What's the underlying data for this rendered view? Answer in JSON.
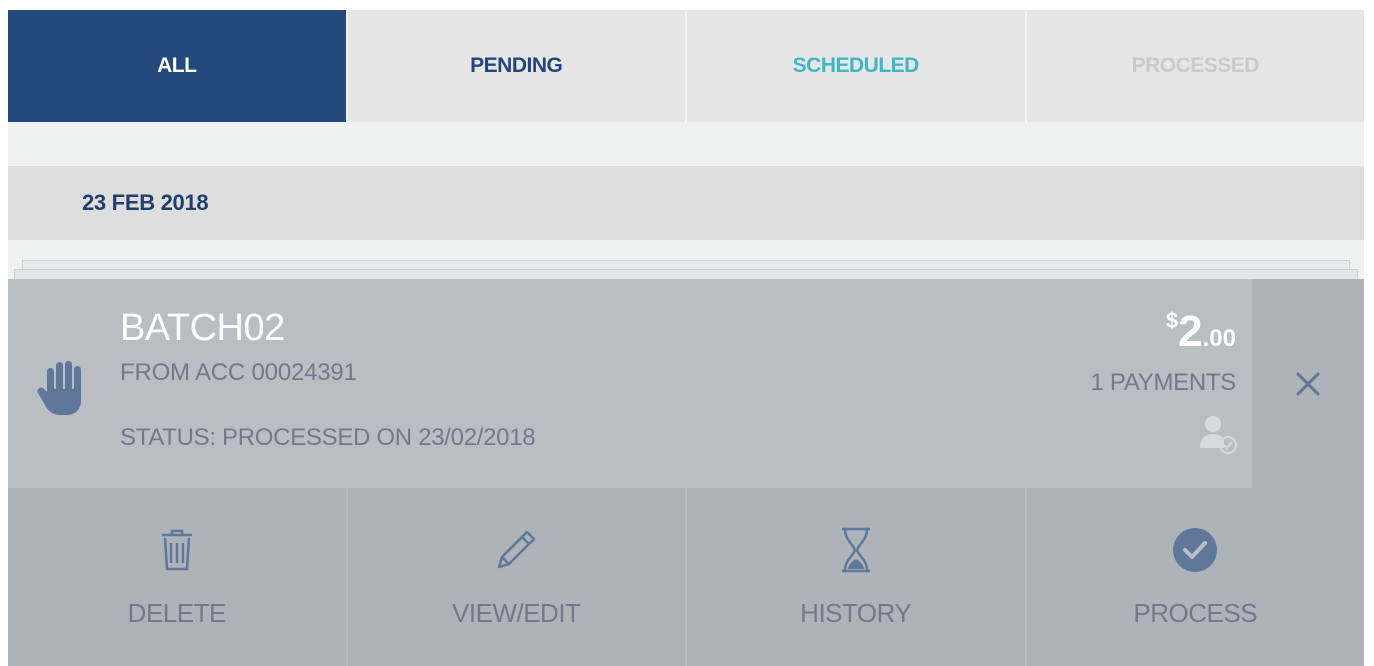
{
  "tabs": [
    {
      "label": "ALL",
      "state": "active"
    },
    {
      "label": "PENDING",
      "state": "normal"
    },
    {
      "label": "SCHEDULED",
      "state": "normal"
    },
    {
      "label": "PROCESSED",
      "state": "disabled"
    }
  ],
  "date_header": "23 FEB 2018",
  "batch": {
    "name": "BATCH02",
    "from_account": "FROM ACC 00024391",
    "status": "STATUS: PROCESSED ON 23/02/2018",
    "amount": {
      "currency": "$",
      "major": "2",
      "minor": ".00"
    },
    "payments": "1 PAYMENTS",
    "icons": {
      "left": "hand-stop-icon",
      "user": "user-approved-icon",
      "close": "close-icon"
    }
  },
  "actions": [
    {
      "label": "DELETE",
      "icon": "trash-icon"
    },
    {
      "label": "VIEW/EDIT",
      "icon": "pencil-icon"
    },
    {
      "label": "HISTORY",
      "icon": "hourglass-icon"
    },
    {
      "label": "PROCESS",
      "icon": "check-circle-icon"
    }
  ],
  "colors": {
    "tab_active_bg": "#24497d",
    "tab_pending": "#23467a",
    "tab_scheduled": "#3fb6c4",
    "tab_processed": "#c8cacd",
    "card_bg": "#b9bec5",
    "icon": "#5f7899",
    "muted_text": "#72798a"
  }
}
